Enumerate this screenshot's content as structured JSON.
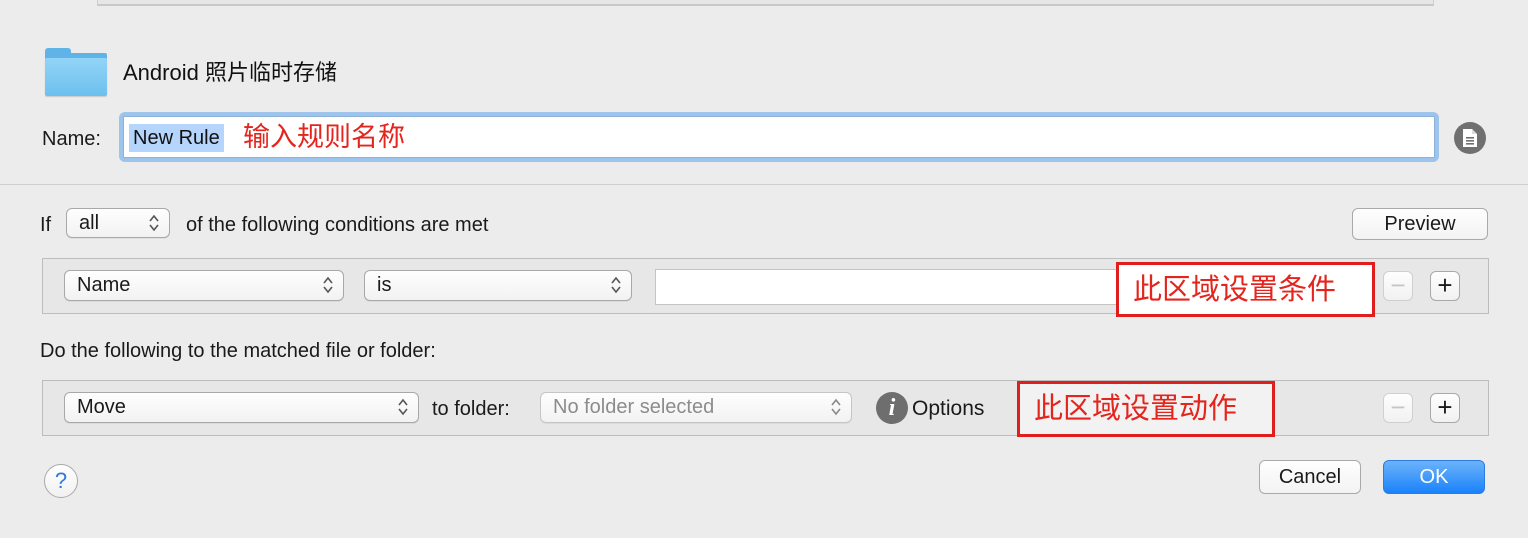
{
  "header": {
    "folder_title": "Android 照片临时存储",
    "name_label": "Name:",
    "name_value": "New Rule",
    "name_annotation": "输入规则名称"
  },
  "conditions": {
    "if_label": "If",
    "match_select": "all",
    "suffix_text": "of the following conditions are met",
    "preview_label": "Preview",
    "attribute_select": "Name",
    "operator_select": "is",
    "value_input": "",
    "annotation": "此区域设置条件",
    "remove_symbol": "−",
    "add_symbol": "+"
  },
  "actions": {
    "heading": "Do the following to the matched file or folder:",
    "action_select": "Move",
    "to_folder_label": "to folder:",
    "folder_select": "No folder selected",
    "options_label": "Options",
    "info_symbol": "i",
    "annotation": "此区域设置动作",
    "remove_symbol": "−",
    "add_symbol": "+"
  },
  "footer": {
    "help_symbol": "?",
    "cancel_label": "Cancel",
    "ok_label": "OK"
  },
  "colors": {
    "accent": "#1a82fb",
    "annotation_red": "#e3251d",
    "folder_blue": "#6cc0ee",
    "selection": "#b5d5fc"
  },
  "icons": [
    "folder-icon",
    "document-icon",
    "chevron-updown-icon",
    "info-icon",
    "help-icon"
  ]
}
